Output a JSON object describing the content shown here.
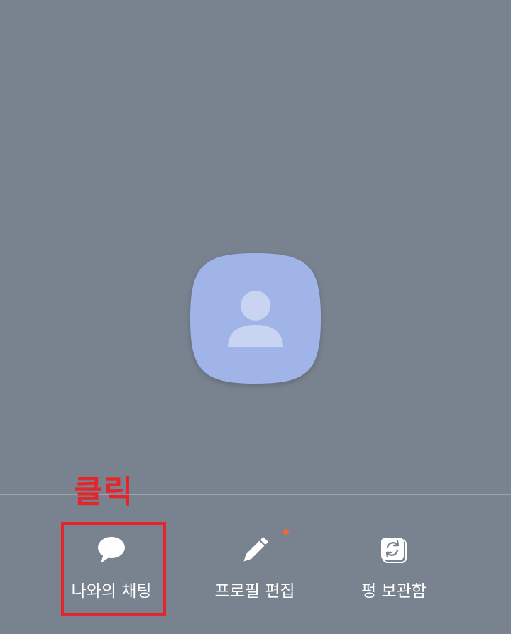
{
  "profile": {
    "avatar_icon": "person-icon",
    "avatar_color": "#a1b4e8",
    "avatar_figure_color": "#c9d4f2"
  },
  "annotation": {
    "callout_text": "클릭",
    "color": "#e3262c"
  },
  "actions": [
    {
      "label": "나와의 채팅",
      "icon": "chat-bubble-icon",
      "highlighted": true
    },
    {
      "label": "프로필 편집",
      "icon": "pencil-icon",
      "has_badge": true
    },
    {
      "label": "펑 보관함",
      "icon": "archive-refresh-icon"
    }
  ],
  "badge": {
    "color": "#f0683a"
  }
}
